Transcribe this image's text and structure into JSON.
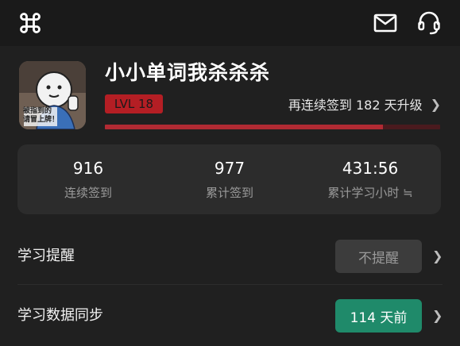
{
  "profile": {
    "username": "小小单词我杀杀杀",
    "level": "LVL 18",
    "levelup_text": "再连续签到 182 天升级",
    "level_progress": 0.83,
    "avatar_caption": "被指到的\n请冒上牌！"
  },
  "stats": [
    {
      "value": "916",
      "label": "连续签到"
    },
    {
      "value": "977",
      "label": "累计签到"
    },
    {
      "value": "431:56",
      "label": "累计学习小时 ≒"
    }
  ],
  "settings": {
    "reminder": {
      "title": "学习提醒",
      "button": "不提醒"
    },
    "sync": {
      "title": "学习数据同步",
      "button": "114 天前"
    }
  },
  "icons": {
    "app": "command-icon",
    "mail": "mail-icon",
    "support": "headset-icon",
    "chevron": "chevron-right-icon"
  },
  "colors": {
    "accent_red": "#b41e24",
    "accent_green": "#1f8a6a"
  }
}
